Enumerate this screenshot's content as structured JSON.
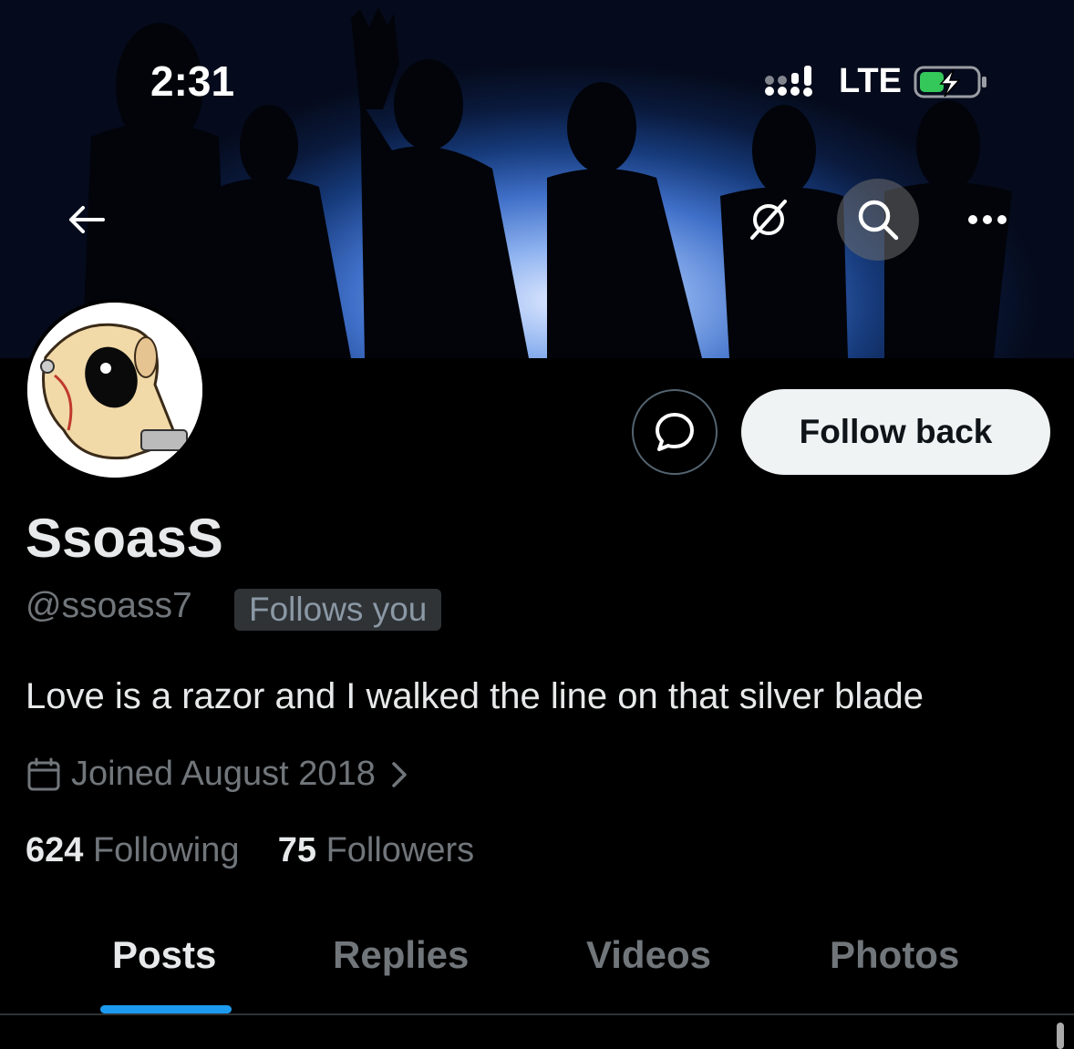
{
  "status_bar": {
    "time": "2:31",
    "network": "LTE"
  },
  "profile": {
    "display_name": "SsoasS",
    "handle": "@ssoass7",
    "follows_you_badge": "Follows you",
    "bio": "Love is a razor and I walked the line on that silver blade",
    "joined": "Joined August 2018",
    "following_count": "624",
    "following_label": "Following",
    "followers_count": "75",
    "followers_label": "Followers"
  },
  "actions": {
    "follow_back_label": "Follow back"
  },
  "tabs": [
    {
      "label": "Posts",
      "active": true
    },
    {
      "label": "Replies",
      "active": false
    },
    {
      "label": "Videos",
      "active": false
    },
    {
      "label": "Photos",
      "active": false
    }
  ],
  "colors": {
    "accent": "#1d9bf0",
    "background": "#000000",
    "battery": "#34c759"
  },
  "icons": [
    "back-arrow-icon",
    "grok-icon",
    "search-icon",
    "more-icon",
    "message-icon",
    "calendar-icon",
    "chevron-right-icon"
  ]
}
